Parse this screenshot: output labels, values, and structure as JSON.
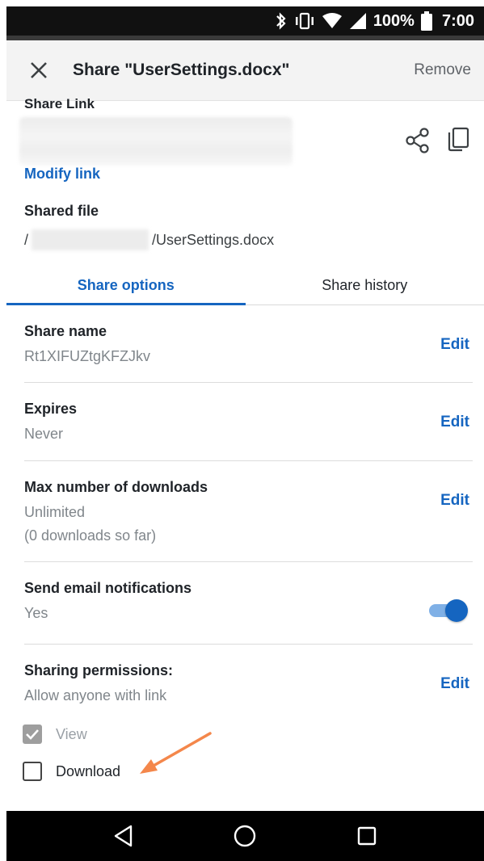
{
  "status_bar": {
    "battery": "100%",
    "time": "7:00",
    "icons": [
      "bluetooth-icon",
      "vibrate-icon",
      "wifi-icon",
      "signal-icon",
      "battery-icon"
    ]
  },
  "app_bar": {
    "title": "Share \"UserSettings.docx\"",
    "remove_label": "Remove",
    "close_icon": "close-icon"
  },
  "share_link": {
    "label": "Share Link",
    "modify_label": "Modify link",
    "share_icon": "share-icon",
    "copy_icon": "copy-icon"
  },
  "shared_file": {
    "label": "Shared file",
    "path_prefix": "/",
    "path_suffix": "/UserSettings.docx"
  },
  "tabs": [
    {
      "label": "Share options",
      "active": true
    },
    {
      "label": "Share history",
      "active": false
    }
  ],
  "options": {
    "share_name": {
      "label": "Share name",
      "value": "Rt1XIFUZtgKFZJkv",
      "edit": "Edit"
    },
    "expires": {
      "label": "Expires",
      "value": "Never",
      "edit": "Edit"
    },
    "max_downloads": {
      "label": "Max number of downloads",
      "value": "Unlimited",
      "value2": "(0 downloads so far)",
      "edit": "Edit"
    },
    "email_notifications": {
      "label": "Send email notifications",
      "value": "Yes",
      "enabled": true
    },
    "permissions": {
      "label": "Sharing permissions:",
      "value": "Allow anyone with link",
      "edit": "Edit"
    }
  },
  "permissions_checkboxes": [
    {
      "label": "View",
      "checked": true,
      "disabled": true
    },
    {
      "label": "Download",
      "checked": false,
      "disabled": false
    }
  ],
  "colors": {
    "accent": "#1565c0",
    "annotation_arrow": "#f4874b"
  },
  "nav_bar": {
    "icons": [
      "back-icon",
      "home-icon",
      "recents-icon"
    ]
  }
}
